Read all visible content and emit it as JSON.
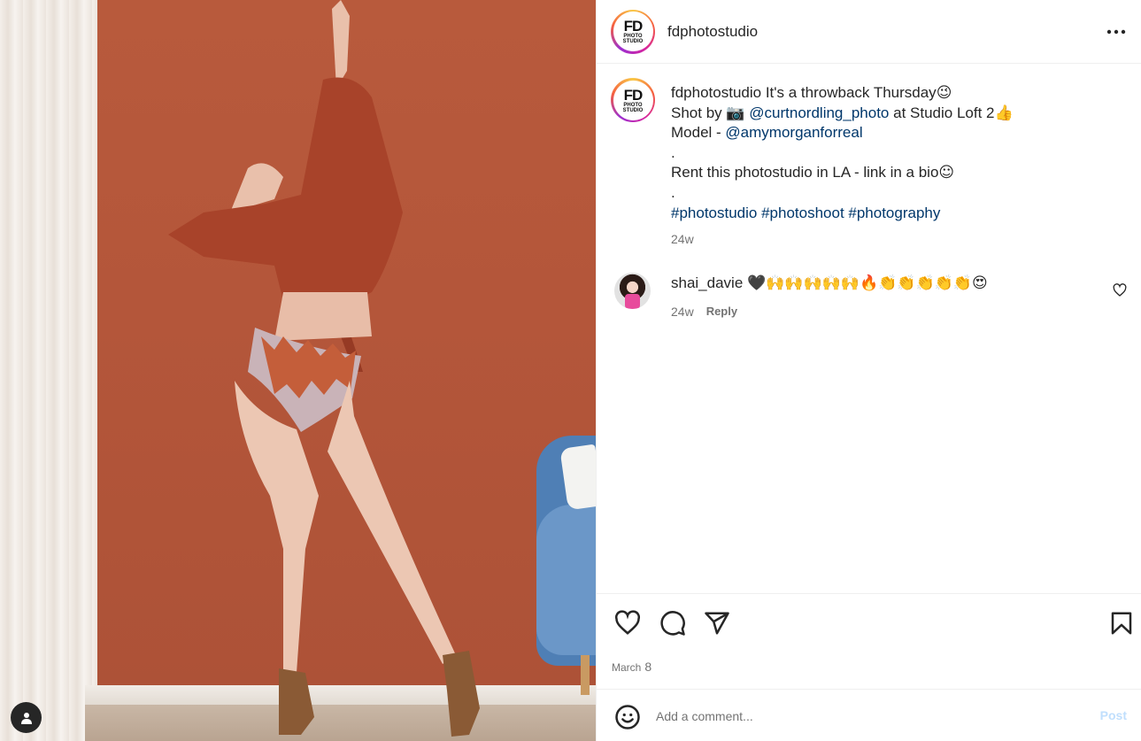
{
  "post": {
    "username": "fdphotostudio",
    "logo_text": "FD",
    "logo_sub": "PHOTO STUDIO",
    "caption": {
      "username": "fdphotostudio",
      "line1": "It's a throwback Thursday",
      "line1_emoji": "😉",
      "line2_prefix": "Shot by",
      "line2_camera": "📷",
      "line2_mention": "@curtnordling_photo",
      "line2_suffix": "at Studio Loft 2",
      "line2_emoji": "👍",
      "line3_prefix": "Model -",
      "line3_mention": "@amymorganforreal",
      "dot1": ".",
      "line4": "Rent this photostudio in LA - link in a bio",
      "line4_emoji": "☺",
      "dot2": ".",
      "hashtags": "#photostudio #photoshoot #photography",
      "time": "24w"
    },
    "comments": [
      {
        "username": "shai_davie",
        "text": "🖤🙌🙌🙌🙌🙌🔥👏👏👏👏👏😍",
        "time": "24w",
        "reply_label": "Reply"
      }
    ],
    "date_month": "March",
    "date_day": "8",
    "composer": {
      "placeholder": "Add a comment...",
      "post_label": "Post"
    }
  },
  "icons": {
    "more": "more-horizontal-icon",
    "like": "heart-icon",
    "comment": "comment-icon",
    "share": "send-icon",
    "save": "bookmark-icon",
    "emoji": "smiley-icon",
    "user_tag": "user-tag-icon"
  },
  "colors": {
    "link": "#00376b",
    "muted": "#737373",
    "post_disabled": "#c0dffd",
    "wall": "#b5583a"
  }
}
